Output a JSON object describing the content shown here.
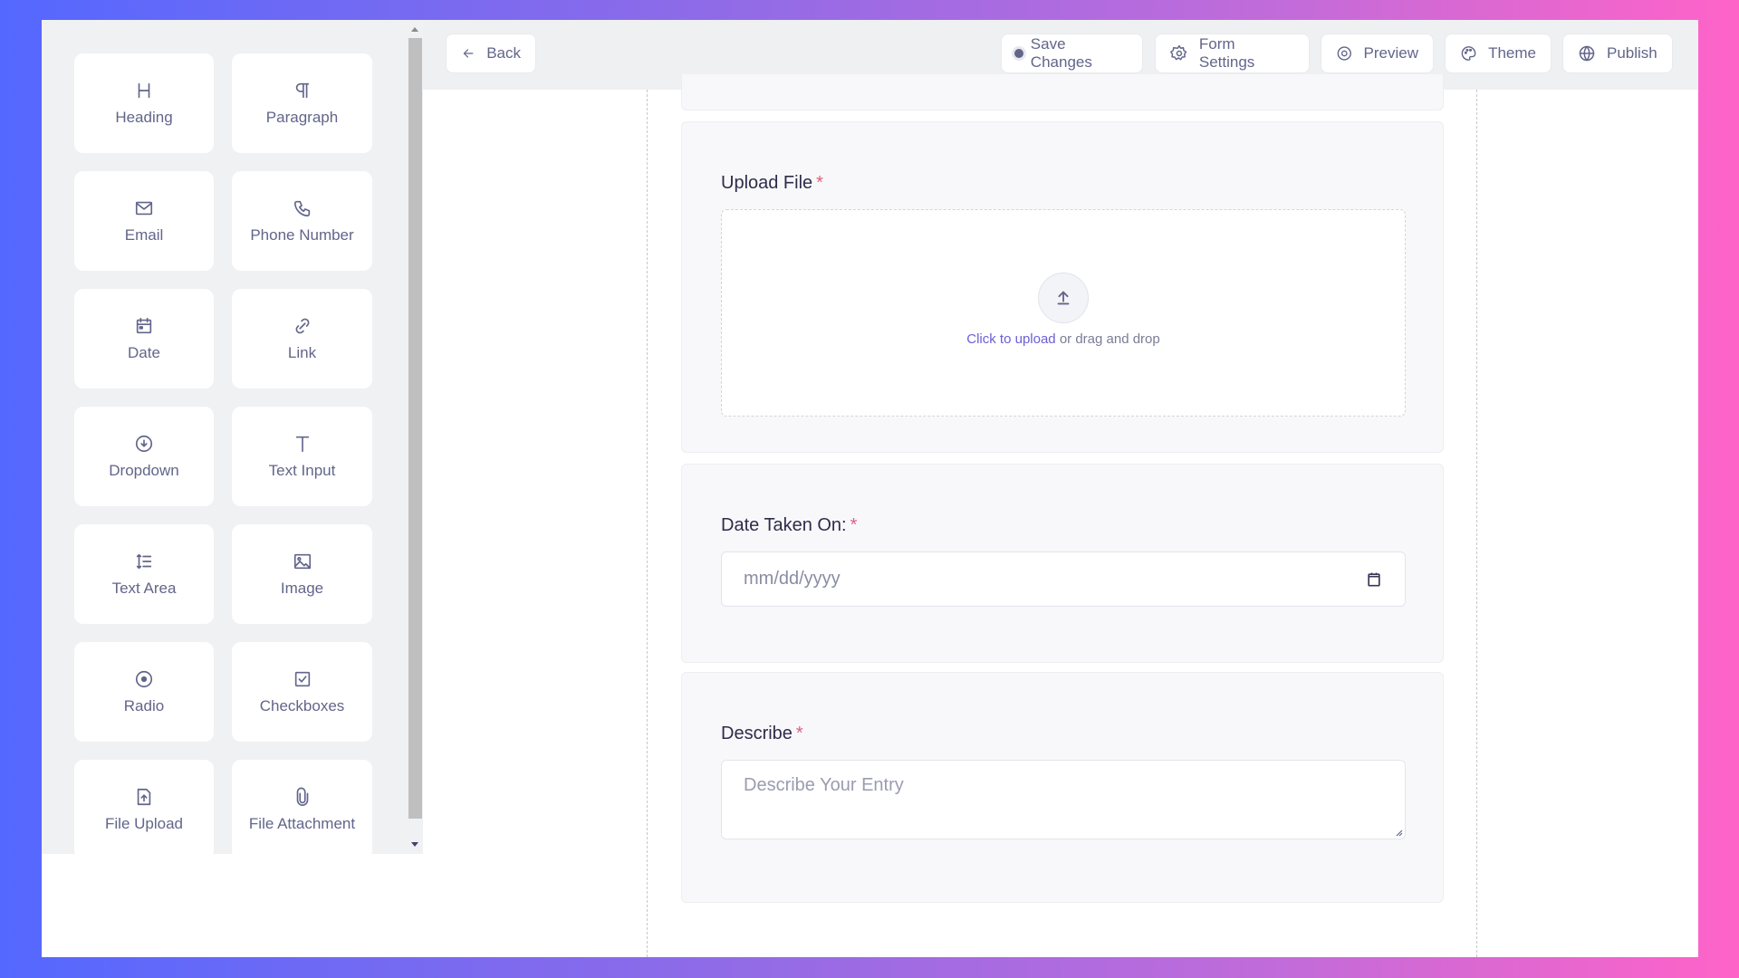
{
  "palette": {
    "items": [
      {
        "label": "Heading",
        "icon": "heading-icon"
      },
      {
        "label": "Paragraph",
        "icon": "paragraph-icon"
      },
      {
        "label": "Email",
        "icon": "email-icon"
      },
      {
        "label": "Phone Number",
        "icon": "phone-icon"
      },
      {
        "label": "Date",
        "icon": "calendar-icon"
      },
      {
        "label": "Link",
        "icon": "link-icon"
      },
      {
        "label": "Dropdown",
        "icon": "dropdown-icon"
      },
      {
        "label": "Text Input",
        "icon": "text-icon"
      },
      {
        "label": "Text Area",
        "icon": "text-area-icon"
      },
      {
        "label": "Image",
        "icon": "image-icon"
      },
      {
        "label": "Radio",
        "icon": "radio-icon"
      },
      {
        "label": "Checkboxes",
        "icon": "checkbox-icon"
      },
      {
        "label": "File Upload",
        "icon": "file-upload-icon"
      },
      {
        "label": "File Attachment",
        "icon": "paperclip-icon"
      }
    ]
  },
  "header": {
    "back_label": "Back",
    "save_label": "Save Changes",
    "settings_label": "Form Settings",
    "preview_label": "Preview",
    "theme_label": "Theme",
    "publish_label": "Publish"
  },
  "form": {
    "upload": {
      "label": "Upload File",
      "required_mark": "*",
      "link_text": "Click to upload",
      "rest_text": " or drag and drop"
    },
    "date": {
      "label": "Date Taken On:",
      "required_mark": "*",
      "placeholder": "mm/dd/yyyy"
    },
    "describe": {
      "label": "Describe",
      "required_mark": "*",
      "placeholder": "Describe Your Entry"
    }
  },
  "colors": {
    "accent": "#6a5fd8",
    "required": "#e0607e",
    "icon": "#62658a"
  }
}
